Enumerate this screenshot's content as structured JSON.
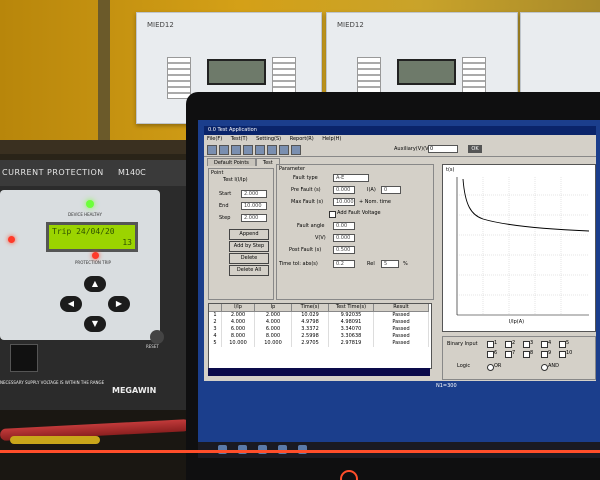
{
  "device": {
    "title": "CURRENT PROTECTION",
    "model": "M140C",
    "healthy_label": "DEVICE HEALTHY",
    "lcd_text": "Trip 24/04/20",
    "lcd_extra": "13",
    "protection_label": "PROTECTION TRIP",
    "reset_label": "RESET",
    "warning_text": "NECESSARY SUPPLY VOLTAGE IS WITHIN THE RANGE",
    "brand": "MEGAWIN",
    "nav_buttons": [
      "▲",
      "◀",
      "▶",
      "▼"
    ]
  },
  "relays": [
    {
      "label": "MIED12"
    },
    {
      "label": "MIED12"
    }
  ],
  "app": {
    "title": "0.0 Test Application",
    "menu": [
      "File(F)",
      "Test(T)",
      "Setting(S)",
      "Report(R)",
      "Help(H)"
    ],
    "toolbar_label": "Auxiliary(V)(V)",
    "toolbar_value": "0",
    "toolbar_ok": "OK",
    "tabs": [
      "Default Points",
      "Test"
    ],
    "point": {
      "group_label": "Point",
      "test_label": "Test I(I/Ip)",
      "start_label": "Start",
      "start_value": "2.000",
      "end_label": "End",
      "end_value": "10.000",
      "step_label": "Step",
      "step_value": "2.000",
      "buttons": [
        "Append",
        "Add by Step",
        "Delete",
        "Delete All"
      ]
    },
    "parameter": {
      "group_label": "Parameter",
      "fault_type_label": "Fault type",
      "fault_type_value": "A-E",
      "pre_fault_label": "Pre Fault (s)",
      "pre_fault_value": "0.000",
      "i_label": "I(A)",
      "i_value": "0",
      "max_fault_label": "Max Fault (s)",
      "max_fault_value": "10.000",
      "nom_time_label": "+ Nom. time",
      "add_voltage_label": "Add Fault Voltage",
      "fault_angle_label": "Fault angle",
      "fault_angle_value": "0.00",
      "vn_label": "V(V)",
      "vn_value": "0.000",
      "post_fault_label": "Post Fault (s)",
      "post_fault_value": "0.500",
      "time_tol_label": "Time tol: abs(s)",
      "time_tol_value": "0.2",
      "rel_label": "Rel",
      "rel_value": "5",
      "rel_unit": "%"
    },
    "table": {
      "headers": [
        "",
        "I/Ip",
        "Ip",
        "Time(s)",
        "Test Time(s)",
        "Result"
      ],
      "rows": [
        [
          "1",
          "2.000",
          "2.000",
          "10.029",
          "9.92035",
          "Passed"
        ],
        [
          "2",
          "4.000",
          "4.000",
          "4.9798",
          "4.98091",
          "Passed"
        ],
        [
          "3",
          "6.000",
          "6.000",
          "3.3372",
          "3.34070",
          "Passed"
        ],
        [
          "4",
          "8.000",
          "8.000",
          "2.5998",
          "3.30638",
          "Passed"
        ],
        [
          "5",
          "10.000",
          "10.000",
          "2.9705",
          "2.97819",
          "Passed"
        ]
      ]
    },
    "graph": {
      "y_label": "t(s)",
      "x_label": "I/Ip(A)"
    },
    "binary": {
      "label": "Binary Input",
      "inputs": [
        "1",
        "2",
        "3",
        "4",
        "5",
        "6",
        "7",
        "8",
        "9",
        "10"
      ],
      "logic_label": "Logic",
      "or_label": "OR",
      "and_label": "AND"
    },
    "status": "N1=300"
  },
  "colors": {
    "screen_blue": "#1b3e8c",
    "lcd_green": "#9bd400",
    "progress": "#ff4e2a"
  }
}
